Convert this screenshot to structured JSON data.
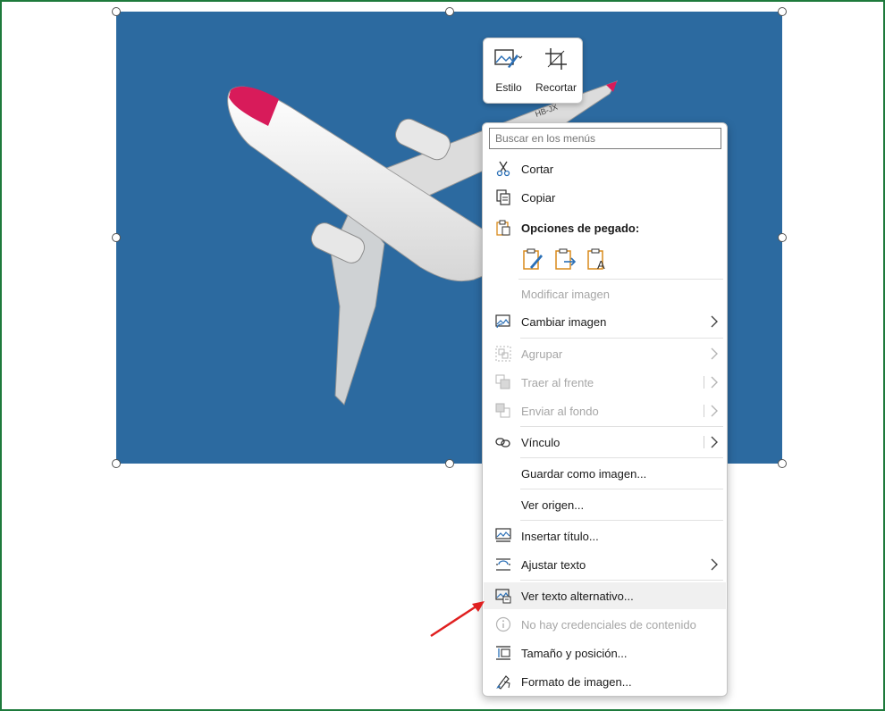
{
  "minibar": {
    "style_label": "Estilo",
    "crop_label": "Recortar"
  },
  "menu": {
    "search_placeholder": "Buscar en los menús",
    "cut": "Cortar",
    "copy": "Copiar",
    "paste_options": "Opciones de pegado:",
    "edit_image": "Modificar imagen",
    "change_image": "Cambiar imagen",
    "group": "Agrupar",
    "bring_front": "Traer al frente",
    "send_back": "Enviar al fondo",
    "link": "Vínculo",
    "save_as_image": "Guardar como imagen...",
    "view_source": "Ver origen...",
    "insert_caption": "Insertar título...",
    "wrap_text": "Ajustar texto",
    "alt_text": "Ver texto alternativo...",
    "no_credentials": "No hay credenciales de contenido",
    "size_position": "Tamaño y posición...",
    "format_image": "Formato de imagen..."
  },
  "colors": {
    "sky": "#2c6aa0",
    "frame_border": "#1e7a3c",
    "annotation_arrow": "#e02020",
    "icon_blue": "#2a6fb6",
    "icon_orange": "#d98a1b"
  }
}
